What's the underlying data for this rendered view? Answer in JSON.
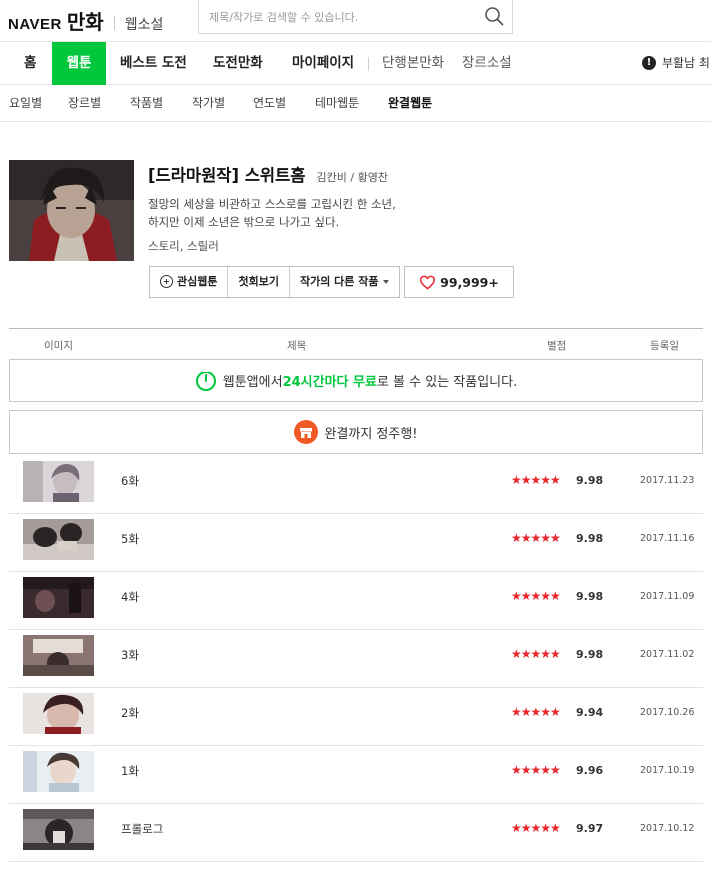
{
  "header": {
    "logo_naver": "NAVER",
    "logo_manhwa": "만화",
    "logo_websoseol": "웹소설",
    "search_placeholder": "제목/작가로 검색할 수 있습니다."
  },
  "main_nav": {
    "items": [
      "홈",
      "웹툰",
      "베스트 도전",
      "도전만화",
      "마이페이지",
      "단행본만화",
      "장르소설"
    ],
    "active": "웹툰",
    "notice_text": "부활남 최"
  },
  "sub_nav": {
    "items": [
      "요일별",
      "장르별",
      "작품별",
      "작가별",
      "연도별",
      "테마웹툰",
      "완결웹툰"
    ],
    "active": "완결웹툰"
  },
  "comic": {
    "title": "[드라마원작] 스위트홈",
    "author": "김칸비 / 황영찬",
    "synopsis_line1": "절망의 세상을 비관하고 스스로를 고립시킨 한 소년,",
    "synopsis_line2": "하지만 이제 소년은 밖으로 나가고 싶다.",
    "genre": "스토리, 스릴러",
    "buttons": {
      "favorite": "관심웹툰",
      "first_episode": "첫회보기",
      "other_works": "작가의 다른 작품"
    },
    "likes": "99,999+"
  },
  "table": {
    "headers": {
      "image": "이미지",
      "title": "제목",
      "rating": "별점",
      "date": "등록일"
    },
    "banner_free": {
      "prefix": "웹툰앱에서 ",
      "highlight": "24시간마다 무료",
      "suffix": "로 볼 수 있는 작품입니다."
    },
    "banner_binge": "완결까지 정주행!",
    "episodes": [
      {
        "title": "6화",
        "stars": "★★★★★",
        "score": "9.98",
        "date": "2017.11.23"
      },
      {
        "title": "5화",
        "stars": "★★★★★",
        "score": "9.98",
        "date": "2017.11.16"
      },
      {
        "title": "4화",
        "stars": "★★★★★",
        "score": "9.98",
        "date": "2017.11.09"
      },
      {
        "title": "3화",
        "stars": "★★★★★",
        "score": "9.98",
        "date": "2017.11.02"
      },
      {
        "title": "2화",
        "stars": "★★★★★",
        "score": "9.94",
        "date": "2017.10.26"
      },
      {
        "title": "1화",
        "stars": "★★★★★",
        "score": "9.96",
        "date": "2017.10.19"
      },
      {
        "title": "프롤로그",
        "stars": "★★★★★",
        "score": "9.97",
        "date": "2017.10.12"
      }
    ]
  },
  "colors": {
    "brand_green": "#00c73c",
    "star_red": "#e8262b",
    "heart_red": "#e8262b",
    "shop_orange": "#f15a24"
  }
}
